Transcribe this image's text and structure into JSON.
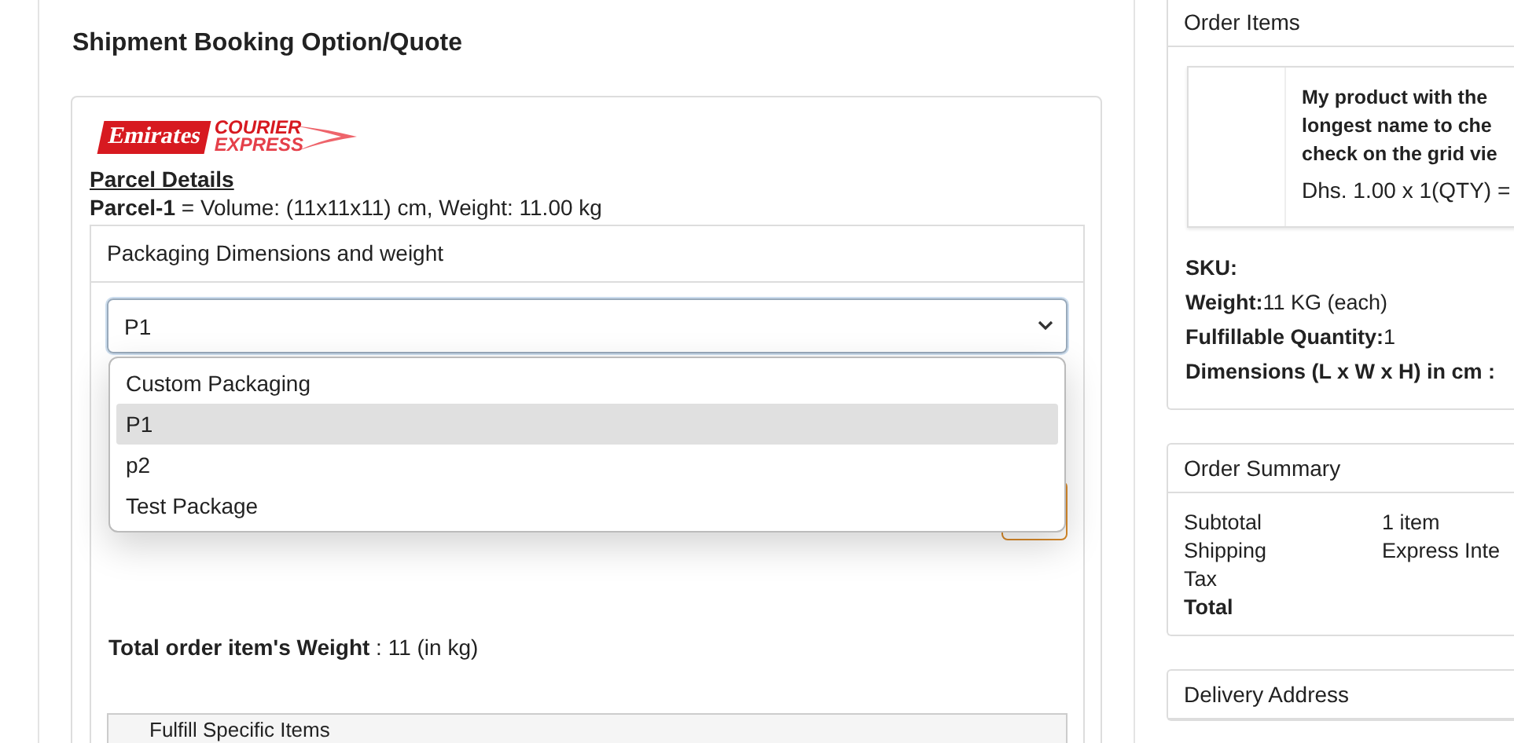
{
  "page_title": "Shipment Booking Option/Quote",
  "carrier_logo": {
    "name": "Emirates",
    "line_1": "COURIER",
    "line_2": "EXPRESS"
  },
  "parcel": {
    "heading": "Parcel Details",
    "label": "Parcel-1",
    "summary": "= Volume: (11x11x11) cm, Weight: 11.00 kg"
  },
  "packaging": {
    "title": "Packaging Dimensions and weight",
    "select": {
      "value": "P1",
      "open": true
    },
    "options": [
      {
        "label": "Custom Packaging",
        "selected": false
      },
      {
        "label": "P1",
        "selected": true
      },
      {
        "label": "p2",
        "selected": false
      },
      {
        "label": "Test Package",
        "selected": false
      }
    ]
  },
  "total_weight": {
    "label": "Total order item's Weight",
    "value": ": 11 (in kg)"
  },
  "fulfill": {
    "label": "Fulfill Specific Items"
  },
  "order_items": {
    "title": "Order Items",
    "product": {
      "name_lines": [
        "My product with the",
        "longest name to che",
        "check on the grid vie"
      ],
      "price": "Dhs. 1.00 x 1(QTY) ="
    },
    "details": [
      {
        "label": "SKU:"
      },
      {
        "label": "Weight:",
        "value": "11 KG (each)"
      },
      {
        "label": "Fulfillable Quantity:",
        "value": "1"
      },
      {
        "label": "Dimensions (L x W x H) in cm :"
      }
    ]
  },
  "order_summary": {
    "title": "Order Summary",
    "rows": [
      {
        "label": "Subtotal",
        "value": "1 item",
        "bold": false
      },
      {
        "label": "Shipping",
        "value": "Express Inte",
        "bold": false
      },
      {
        "label": "Tax",
        "bold": false
      },
      {
        "label": "Total",
        "bold": true
      }
    ]
  },
  "delivery_address": {
    "title": "Delivery Address"
  }
}
